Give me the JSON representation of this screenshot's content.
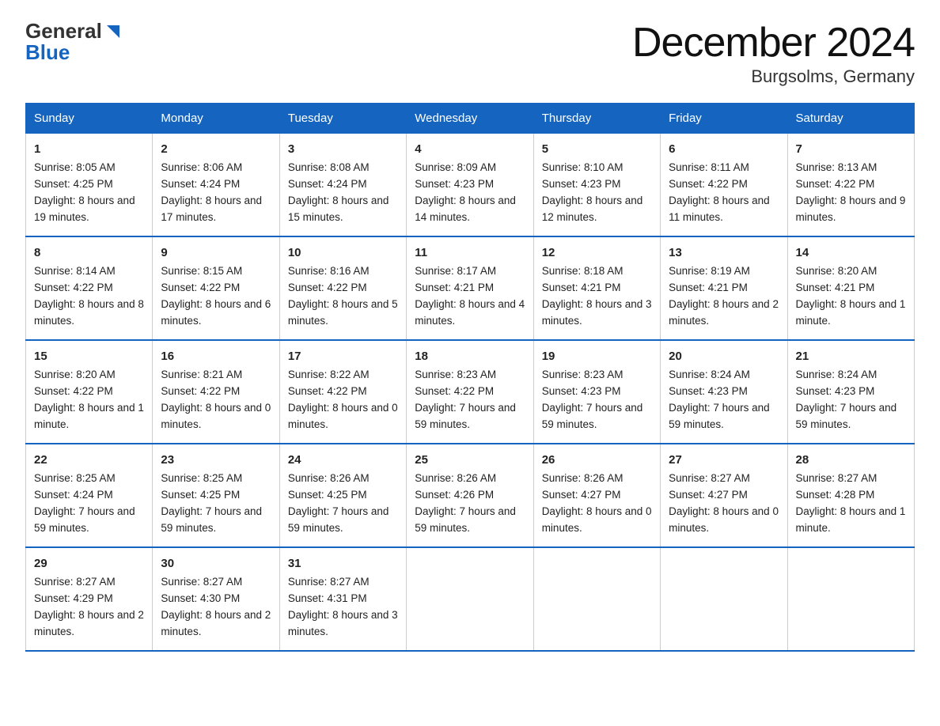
{
  "logo": {
    "line1": "General",
    "line2": "Blue"
  },
  "title": "December 2024",
  "subtitle": "Burgsolms, Germany",
  "days": [
    "Sunday",
    "Monday",
    "Tuesday",
    "Wednesday",
    "Thursday",
    "Friday",
    "Saturday"
  ],
  "weeks": [
    [
      {
        "num": "1",
        "sunrise": "8:05 AM",
        "sunset": "4:25 PM",
        "daylight": "8 hours and 19 minutes."
      },
      {
        "num": "2",
        "sunrise": "8:06 AM",
        "sunset": "4:24 PM",
        "daylight": "8 hours and 17 minutes."
      },
      {
        "num": "3",
        "sunrise": "8:08 AM",
        "sunset": "4:24 PM",
        "daylight": "8 hours and 15 minutes."
      },
      {
        "num": "4",
        "sunrise": "8:09 AM",
        "sunset": "4:23 PM",
        "daylight": "8 hours and 14 minutes."
      },
      {
        "num": "5",
        "sunrise": "8:10 AM",
        "sunset": "4:23 PM",
        "daylight": "8 hours and 12 minutes."
      },
      {
        "num": "6",
        "sunrise": "8:11 AM",
        "sunset": "4:22 PM",
        "daylight": "8 hours and 11 minutes."
      },
      {
        "num": "7",
        "sunrise": "8:13 AM",
        "sunset": "4:22 PM",
        "daylight": "8 hours and 9 minutes."
      }
    ],
    [
      {
        "num": "8",
        "sunrise": "8:14 AM",
        "sunset": "4:22 PM",
        "daylight": "8 hours and 8 minutes."
      },
      {
        "num": "9",
        "sunrise": "8:15 AM",
        "sunset": "4:22 PM",
        "daylight": "8 hours and 6 minutes."
      },
      {
        "num": "10",
        "sunrise": "8:16 AM",
        "sunset": "4:22 PM",
        "daylight": "8 hours and 5 minutes."
      },
      {
        "num": "11",
        "sunrise": "8:17 AM",
        "sunset": "4:21 PM",
        "daylight": "8 hours and 4 minutes."
      },
      {
        "num": "12",
        "sunrise": "8:18 AM",
        "sunset": "4:21 PM",
        "daylight": "8 hours and 3 minutes."
      },
      {
        "num": "13",
        "sunrise": "8:19 AM",
        "sunset": "4:21 PM",
        "daylight": "8 hours and 2 minutes."
      },
      {
        "num": "14",
        "sunrise": "8:20 AM",
        "sunset": "4:21 PM",
        "daylight": "8 hours and 1 minute."
      }
    ],
    [
      {
        "num": "15",
        "sunrise": "8:20 AM",
        "sunset": "4:22 PM",
        "daylight": "8 hours and 1 minute."
      },
      {
        "num": "16",
        "sunrise": "8:21 AM",
        "sunset": "4:22 PM",
        "daylight": "8 hours and 0 minutes."
      },
      {
        "num": "17",
        "sunrise": "8:22 AM",
        "sunset": "4:22 PM",
        "daylight": "8 hours and 0 minutes."
      },
      {
        "num": "18",
        "sunrise": "8:23 AM",
        "sunset": "4:22 PM",
        "daylight": "7 hours and 59 minutes."
      },
      {
        "num": "19",
        "sunrise": "8:23 AM",
        "sunset": "4:23 PM",
        "daylight": "7 hours and 59 minutes."
      },
      {
        "num": "20",
        "sunrise": "8:24 AM",
        "sunset": "4:23 PM",
        "daylight": "7 hours and 59 minutes."
      },
      {
        "num": "21",
        "sunrise": "8:24 AM",
        "sunset": "4:23 PM",
        "daylight": "7 hours and 59 minutes."
      }
    ],
    [
      {
        "num": "22",
        "sunrise": "8:25 AM",
        "sunset": "4:24 PM",
        "daylight": "7 hours and 59 minutes."
      },
      {
        "num": "23",
        "sunrise": "8:25 AM",
        "sunset": "4:25 PM",
        "daylight": "7 hours and 59 minutes."
      },
      {
        "num": "24",
        "sunrise": "8:26 AM",
        "sunset": "4:25 PM",
        "daylight": "7 hours and 59 minutes."
      },
      {
        "num": "25",
        "sunrise": "8:26 AM",
        "sunset": "4:26 PM",
        "daylight": "7 hours and 59 minutes."
      },
      {
        "num": "26",
        "sunrise": "8:26 AM",
        "sunset": "4:27 PM",
        "daylight": "8 hours and 0 minutes."
      },
      {
        "num": "27",
        "sunrise": "8:27 AM",
        "sunset": "4:27 PM",
        "daylight": "8 hours and 0 minutes."
      },
      {
        "num": "28",
        "sunrise": "8:27 AM",
        "sunset": "4:28 PM",
        "daylight": "8 hours and 1 minute."
      }
    ],
    [
      {
        "num": "29",
        "sunrise": "8:27 AM",
        "sunset": "4:29 PM",
        "daylight": "8 hours and 2 minutes."
      },
      {
        "num": "30",
        "sunrise": "8:27 AM",
        "sunset": "4:30 PM",
        "daylight": "8 hours and 2 minutes."
      },
      {
        "num": "31",
        "sunrise": "8:27 AM",
        "sunset": "4:31 PM",
        "daylight": "8 hours and 3 minutes."
      },
      null,
      null,
      null,
      null
    ]
  ],
  "labels": {
    "sunrise": "Sunrise:",
    "sunset": "Sunset:",
    "daylight": "Daylight:"
  }
}
